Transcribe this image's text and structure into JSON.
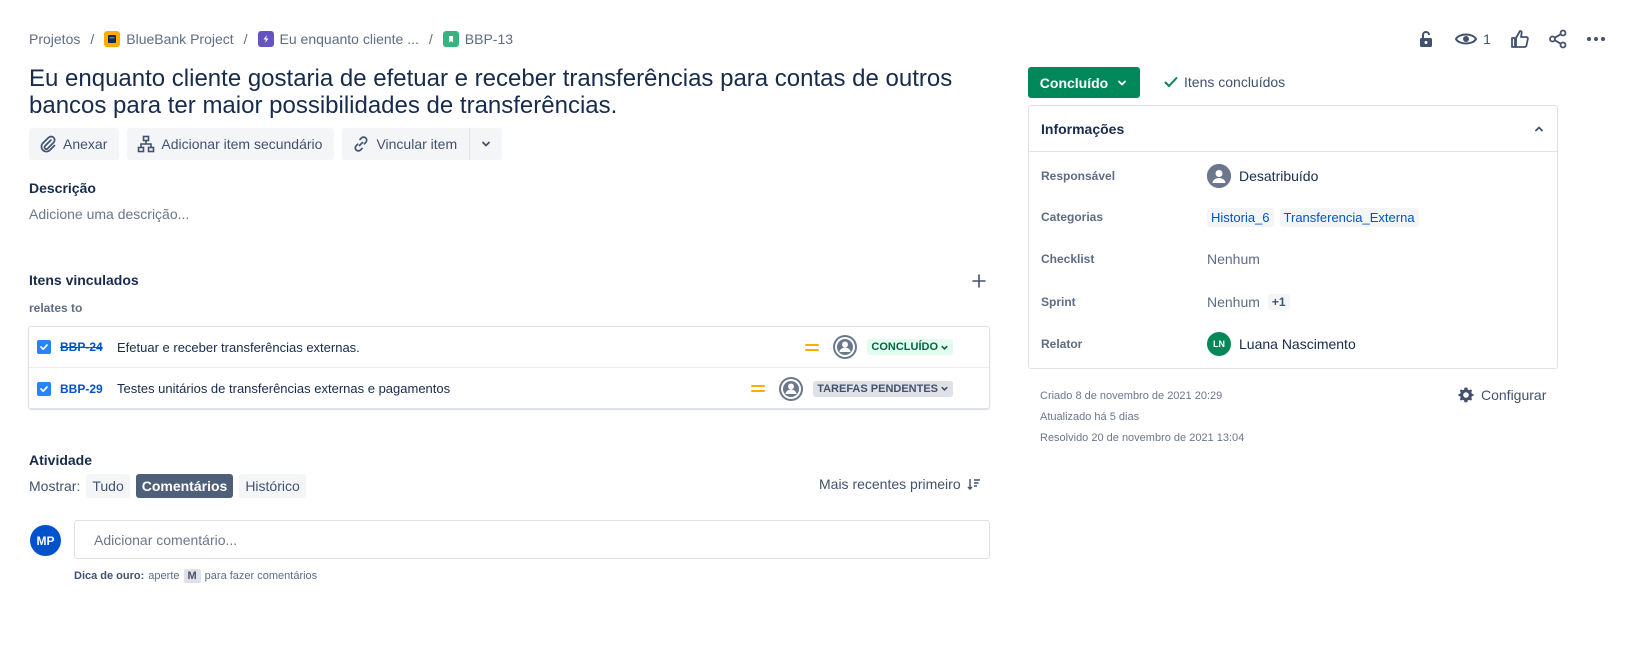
{
  "breadcrumb": {
    "root": "Projetos",
    "project": "BlueBank Project",
    "parent": "Eu enquanto cliente ...",
    "issue": "BBP-13"
  },
  "header": {
    "watch_count": "1"
  },
  "issue": {
    "title": "Eu enquanto cliente gostaria de efetuar e receber transferências para contas de outros bancos para ter maior possibilidades de transferências."
  },
  "actions": {
    "attach": "Anexar",
    "add_child": "Adicionar item secundário",
    "link_item": "Vincular item"
  },
  "description": {
    "heading": "Descrição",
    "placeholder": "Adicione uma descrição..."
  },
  "linked": {
    "heading": "Itens vinculados",
    "relation": "relates to",
    "items": [
      {
        "key": "BBP-24",
        "summary": "Efetuar e receber transferências externas.",
        "status": "CONCLUÍDO"
      },
      {
        "key": "BBP-29",
        "summary": "Testes unitários de transferências externas e pagamentos",
        "status": "TAREFAS PENDENTES"
      }
    ]
  },
  "activity": {
    "heading": "Atividade",
    "show_label": "Mostrar:",
    "filters": [
      "Tudo",
      "Comentários",
      "Histórico"
    ],
    "sort": "Mais recentes primeiro",
    "avatar_initials": "MP",
    "comment_placeholder": "Adicionar comentário...",
    "tip_label": "Dica de ouro:",
    "tip_press": "aperte",
    "tip_key": "M",
    "tip_rest": "para fazer comentários"
  },
  "status": {
    "label": "Concluído",
    "resolution": "Itens concluídos"
  },
  "details": {
    "heading": "Informações",
    "assignee_label": "Responsável",
    "assignee": "Desatribuído",
    "labels_label": "Categorias",
    "labels": [
      "Historia_6",
      "Transferencia_Externa"
    ],
    "checklist_label": "Checklist",
    "checklist": "Nenhum",
    "sprint_label": "Sprint",
    "sprint": "Nenhum",
    "sprint_extra": "+1",
    "reporter_label": "Relator",
    "reporter_initials": "LN",
    "reporter": "Luana Nascimento"
  },
  "meta": {
    "created": "Criado 8 de novembro de 2021 20:29",
    "updated": "Atualizado há 5 dias",
    "resolved": "Resolvido 20 de novembro de 2021 13:04",
    "configure": "Configurar"
  },
  "colors": {
    "done_green": "#00875a",
    "link_blue": "#0052cc",
    "priority_medium": "#ffab00"
  }
}
